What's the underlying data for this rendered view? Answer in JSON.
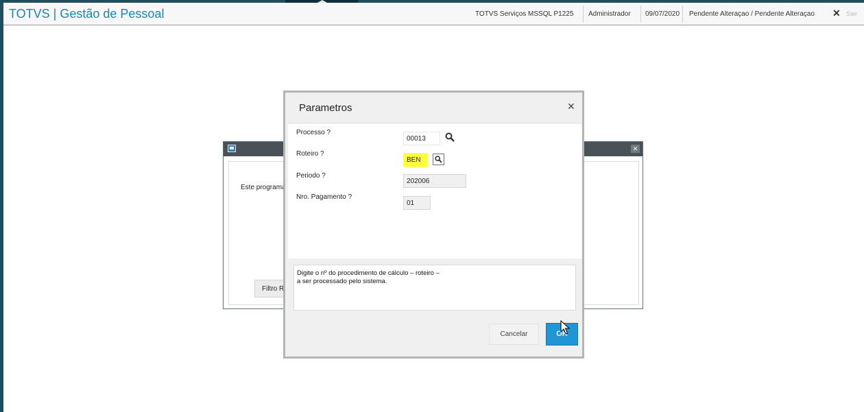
{
  "header": {
    "app_title": "TOTVS | Gestão de Pessoal",
    "environment": "TOTVS Serviços MSSQL P1225",
    "user": "Administrador",
    "date": "09/07/2020",
    "status": "Pendente Alteraçao / Pendente Alteraçao",
    "exit_label": "Sair"
  },
  "background_window": {
    "text": "Este programa",
    "filter_button": "Filtro Ra"
  },
  "dialog": {
    "title": "Parametros",
    "fields": [
      {
        "label": "Processo ?",
        "value": "00013"
      },
      {
        "label": "Roteiro ?",
        "value": "BEN"
      },
      {
        "label": "Periodo ?",
        "value": "202006"
      },
      {
        "label": "Nro. Pagamento ?",
        "value": "01"
      }
    ],
    "help_lines": [
      "Digite o nº do procedimento de cálculo – roteiro –",
      "a ser processado pelo sistema."
    ],
    "cancel_label": "Cancelar",
    "ok_label": "OK"
  },
  "colors": {
    "accent": "#1a86b3",
    "ok_button": "#1f97d6",
    "highlight": "#ffff3a",
    "frame": "#1f4e5f"
  }
}
